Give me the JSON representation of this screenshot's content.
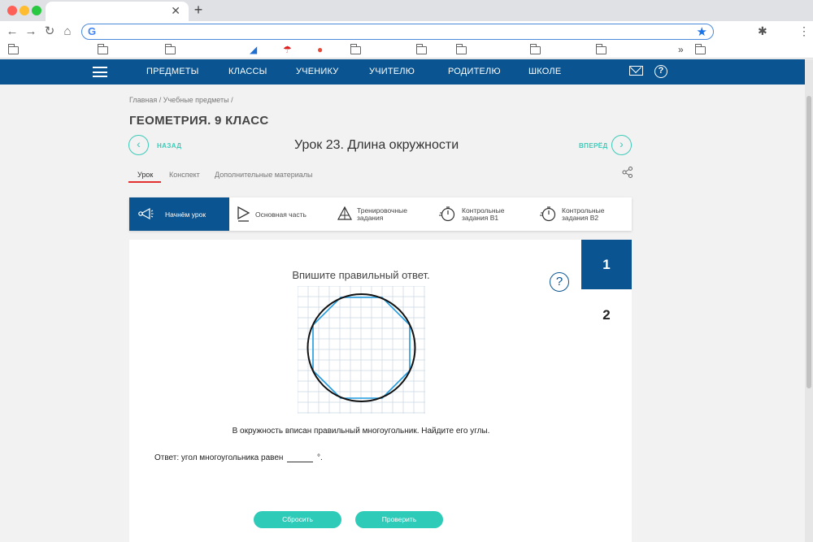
{
  "browser": {
    "star_icon": "star-icon",
    "more_bookmarks": "»"
  },
  "nav": {
    "items": [
      "ПРЕДМЕТЫ",
      "КЛАССЫ",
      "УЧЕНИКУ",
      "УЧИТЕЛЮ",
      "РОДИТЕЛЮ",
      "ШКОЛЕ"
    ],
    "help": "?"
  },
  "breadcrumb": "Главная  /  Учебные предметы  /",
  "page_title": "ГЕОМЕТРИЯ. 9 КЛАСС",
  "nav_lesson": {
    "back": "НАЗАД",
    "forward": "ВПЕРЁД",
    "title": "Урок 23. Длина окружности"
  },
  "subtabs": [
    "Урок",
    "Конспект",
    "Дополнительные материалы"
  ],
  "steps": [
    {
      "line1": "Начнём урок",
      "line2": ""
    },
    {
      "line1": "Основная часть",
      "line2": ""
    },
    {
      "line1": "Тренировочные",
      "line2": "задания"
    },
    {
      "line1": "Контрольные",
      "line2": "задания В1"
    },
    {
      "line1": "Контрольные",
      "line2": "задания В2"
    }
  ],
  "task": {
    "numbers": [
      "1",
      "2"
    ],
    "help": "?",
    "instruction": "Впишите правильный ответ.",
    "question": "В окружность вписан правильный многоугольник. Найдите его углы.",
    "answer_prefix": "Ответ: угол многоугольника равен",
    "answer_suffix": "°.",
    "reset": "Сбросить",
    "check": "Проверить"
  },
  "colors": {
    "brand_blue": "#0a5591",
    "accent_teal": "#2dcbb8",
    "tab_underline": "#e03030",
    "polygon": "#1e9be0"
  }
}
